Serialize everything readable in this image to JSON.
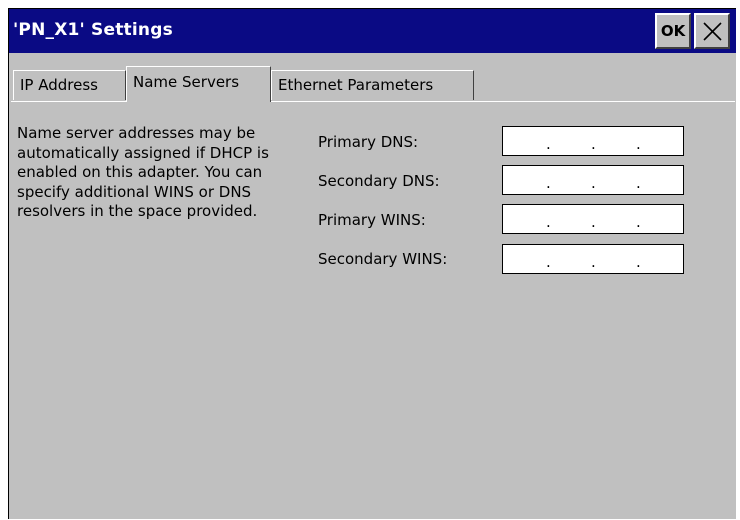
{
  "window": {
    "title": "'PN_X1' Settings",
    "ok_label": "OK"
  },
  "tabs": [
    {
      "label": "IP Address",
      "active": false
    },
    {
      "label": "Name Servers",
      "active": true
    },
    {
      "label": "Ethernet Parameters",
      "active": false
    }
  ],
  "description": "Name server addresses may be automatically assigned if DHCP is enabled on this adapter. You can specify additional WINS or DNS resolvers in the space provided.",
  "fields": [
    {
      "label": "Primary DNS:",
      "value": ". . ."
    },
    {
      "label": "Secondary DNS:",
      "value": ". . ."
    },
    {
      "label": "Primary WINS:",
      "value": ". . ."
    },
    {
      "label": "Secondary WINS:",
      "value": ". . ."
    }
  ],
  "colors": {
    "titlebar": "#0a0a84",
    "face": "#c0c0c0"
  }
}
